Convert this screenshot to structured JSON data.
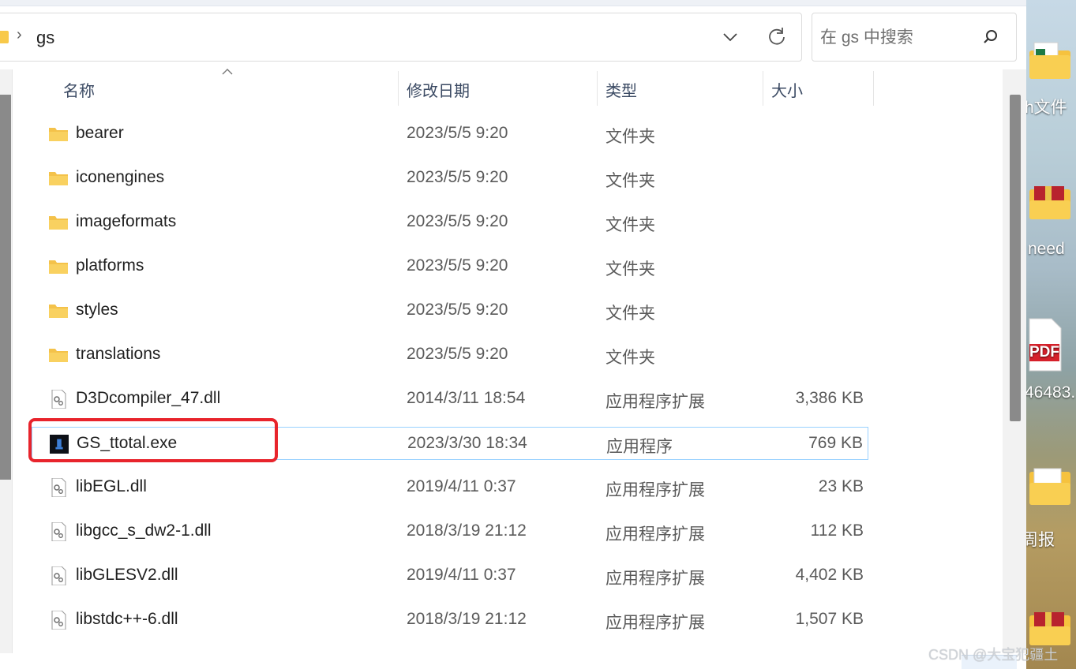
{
  "address": {
    "path": "gs",
    "separator": "›"
  },
  "search": {
    "placeholder": "在 gs 中搜索"
  },
  "columns": {
    "name": "名称",
    "modified": "修改日期",
    "type": "类型",
    "size": "大小"
  },
  "files": [
    {
      "name": "bearer",
      "date": "2023/5/5 9:20",
      "type": "文件夹",
      "size": "",
      "icon": "folder-icon"
    },
    {
      "name": "iconengines",
      "date": "2023/5/5 9:20",
      "type": "文件夹",
      "size": "",
      "icon": "folder-icon"
    },
    {
      "name": "imageformats",
      "date": "2023/5/5 9:20",
      "type": "文件夹",
      "size": "",
      "icon": "folder-icon"
    },
    {
      "name": "platforms",
      "date": "2023/5/5 9:20",
      "type": "文件夹",
      "size": "",
      "icon": "folder-icon"
    },
    {
      "name": "styles",
      "date": "2023/5/5 9:20",
      "type": "文件夹",
      "size": "",
      "icon": "folder-icon"
    },
    {
      "name": "translations",
      "date": "2023/5/5 9:20",
      "type": "文件夹",
      "size": "",
      "icon": "folder-icon"
    },
    {
      "name": "D3Dcompiler_47.dll",
      "date": "2014/3/11 18:54",
      "type": "应用程序扩展",
      "size": "3,386 KB",
      "icon": "dll-file-icon"
    },
    {
      "name": "GS_ttotal.exe",
      "date": "2023/3/30 18:34",
      "type": "应用程序",
      "size": "769 KB",
      "icon": "exe-app-icon"
    },
    {
      "name": "libEGL.dll",
      "date": "2019/4/11 0:37",
      "type": "应用程序扩展",
      "size": "23 KB",
      "icon": "dll-file-icon"
    },
    {
      "name": "libgcc_s_dw2-1.dll",
      "date": "2018/3/19 21:12",
      "type": "应用程序扩展",
      "size": "112 KB",
      "icon": "dll-file-icon"
    },
    {
      "name": "libGLESV2.dll",
      "date": "2019/4/11 0:37",
      "type": "应用程序扩展",
      "size": "4,402 KB",
      "icon": "dll-file-icon"
    },
    {
      "name": "libstdc++-6.dll",
      "date": "2018/3/19 21:12",
      "type": "应用程序扩展",
      "size": "1,507 KB",
      "icon": "dll-file-icon"
    }
  ],
  "desktop": {
    "labels": [
      "h文件",
      "need",
      "46483.",
      "周报"
    ],
    "pdf_badge": "PDF"
  },
  "watermark": "CSDN @大宝犯疆土",
  "colors": {
    "highlight": "#e8242c",
    "selection_border": "#99d1ff",
    "folder": "#f8c94a",
    "header_text": "#3b4a63"
  }
}
